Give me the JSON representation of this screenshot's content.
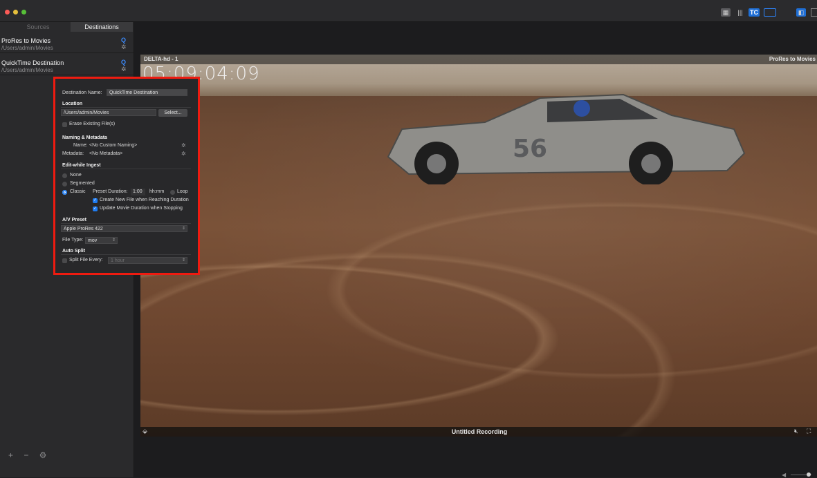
{
  "sidebar": {
    "tabs": [
      "Sources",
      "Destinations"
    ],
    "destinations": [
      {
        "name": "ProRes to Movies",
        "path": "/Users/admin/Movies"
      },
      {
        "name": "QuickTime Destination",
        "path": "/Users/admin/Movies"
      }
    ],
    "bottom_controls": "+ − ⚙"
  },
  "toolbar": {
    "tc_label": "TC"
  },
  "viewer": {
    "source_label": "DELTA-hd - 1",
    "destination_label": "ProRes to Movies",
    "timecode": "05:09:04:09",
    "recording_name": "Untitled Recording"
  },
  "popover": {
    "destination_name_label": "Destination Name:",
    "destination_name_value": "QuickTime Destination",
    "location_heading": "Location",
    "location_path": "/Users/admin/Movies",
    "select_button": "Select...",
    "erase_label": "Erase Existing File(s)",
    "naming_heading": "Naming & Metadata",
    "name_label": "Name:",
    "name_value": "<No Custom Naming>",
    "metadata_label": "Metadata:",
    "metadata_value": "<No Metadata>",
    "ewi_heading": "Edit-while Ingest",
    "opt_none": "None",
    "opt_segmented": "Segmented",
    "opt_classic": "Classic",
    "preset_duration_label": "Preset Duration:",
    "preset_duration_value": "1:00",
    "duration_unit": "hh:mm",
    "loop_label": "Loop",
    "create_new_file_label": "Create New File when Reaching Duration",
    "update_duration_label": "Update Movie Duration when Stopping",
    "av_heading": "A/V Preset",
    "av_preset": "Apple ProRes 422",
    "file_type_label": "File Type:",
    "file_type_value": "mov",
    "autosplit_heading": "Auto Split",
    "split_every_label": "Split File Every:",
    "split_every_value": "1 hour"
  },
  "colors": {
    "accent": "#1f7cf2",
    "highlight_border": "#ef1b10"
  }
}
